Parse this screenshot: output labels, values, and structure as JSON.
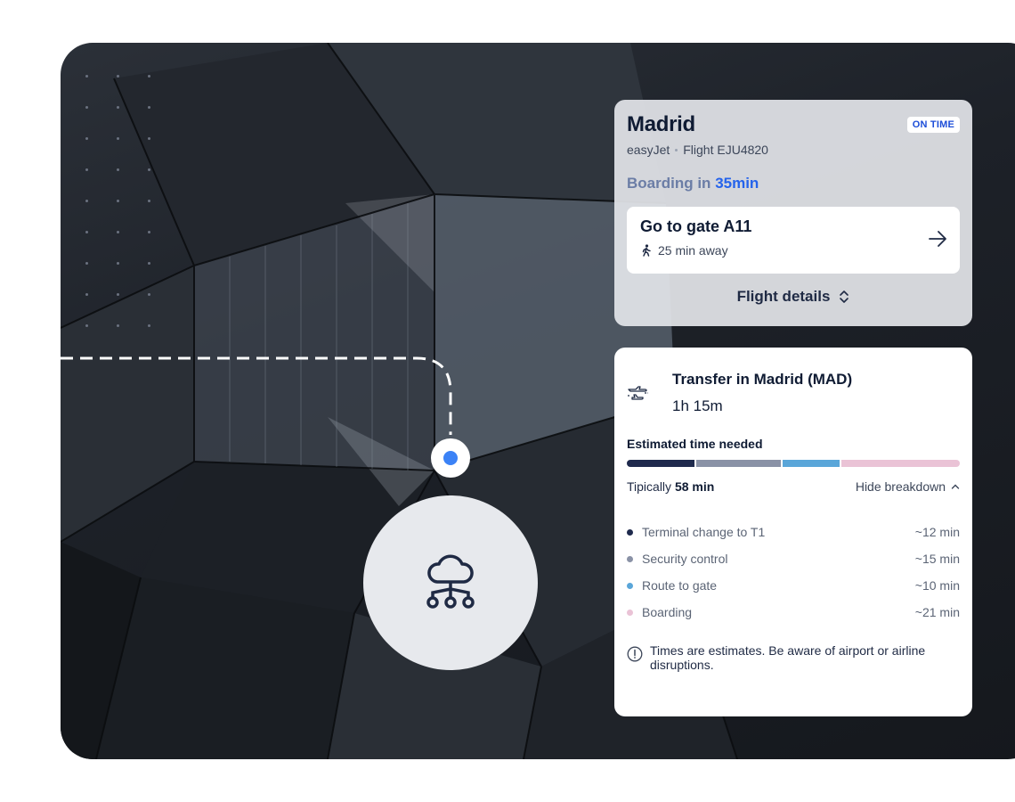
{
  "flight": {
    "city": "Madrid",
    "status": "ON TIME",
    "airline": "easyJet",
    "flight_number": "Flight EJU4820",
    "boarding_prefix": "Boarding in",
    "boarding_time": "35min",
    "gate_title": "Go to gate A11",
    "gate_distance": "25 min away",
    "details_label": "Flight details"
  },
  "transfer": {
    "title": "Transfer in Madrid (MAD)",
    "duration": "1h 15m",
    "estimate_label": "Estimated time needed",
    "typically_prefix": "Tipically",
    "typically_value": "58 min",
    "hide_label": "Hide breakdown",
    "steps": [
      {
        "label": "Terminal change to T1",
        "time": "~12 min",
        "minutes": 12,
        "color": "#1f2a4d"
      },
      {
        "label": "Security control",
        "time": "~15 min",
        "minutes": 15,
        "color": "#8a92a6"
      },
      {
        "label": "Route to gate",
        "time": "~10 min",
        "minutes": 10,
        "color": "#5aa6d9"
      },
      {
        "label": "Boarding",
        "time": "~21 min",
        "minutes": 21,
        "color": "#eac3d6"
      }
    ],
    "note": "Times are estimates. Be aware of airport or airline disruptions."
  },
  "icons": {
    "cloud": "cloud-network-icon",
    "walk": "walking-person-icon",
    "arrow": "arrow-right-icon",
    "chevrons": "chevron-up-down-icon",
    "chevron_up": "chevron-up-icon",
    "transfer": "plane-transfer-icon",
    "info": "info-icon"
  },
  "colors": {
    "accent_blue": "#2563eb",
    "node_blue": "#3b82f6",
    "status_blue": "#1d4ed8"
  }
}
